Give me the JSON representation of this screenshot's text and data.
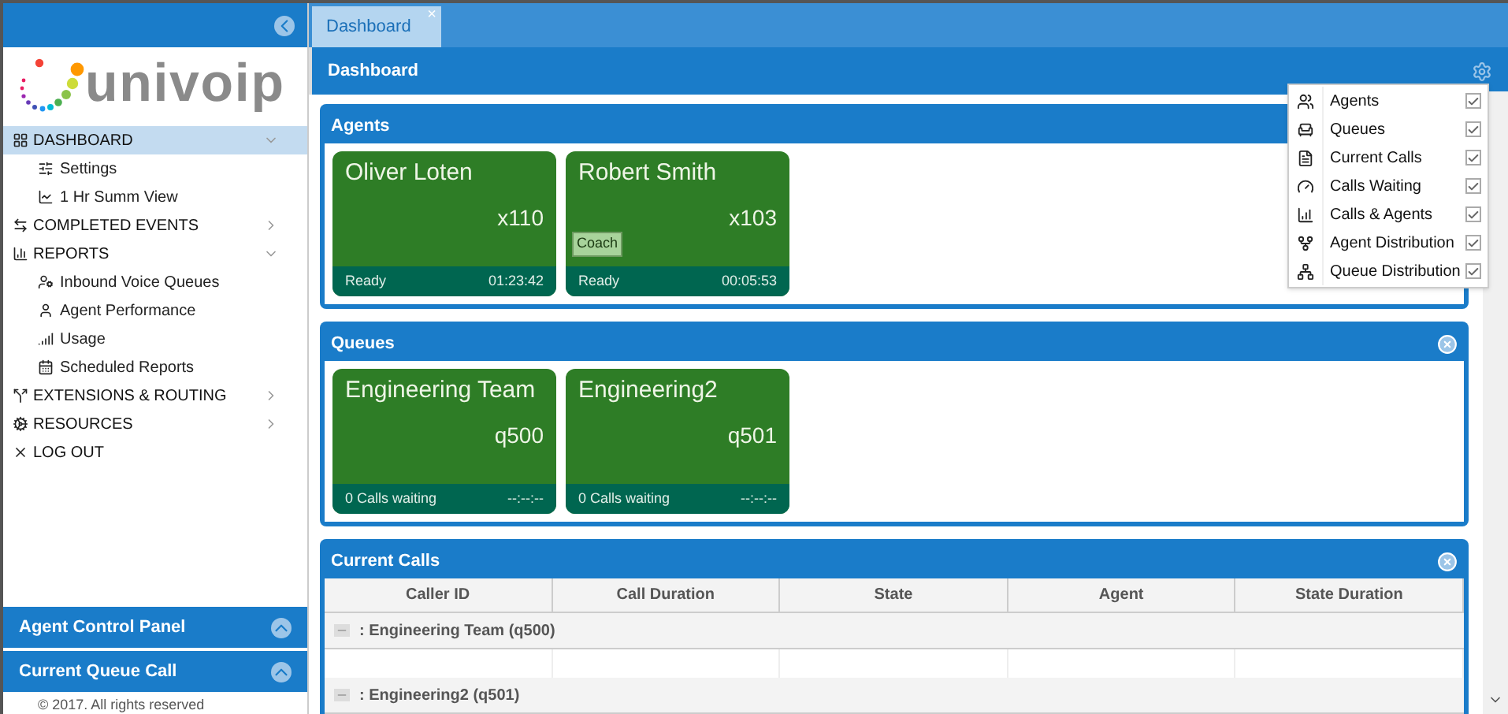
{
  "sidebar": {
    "logo": "univoip",
    "nav": [
      {
        "label": "DASHBOARD",
        "selected": true,
        "expanded": true,
        "children": [
          {
            "label": "Settings"
          },
          {
            "label": "1 Hr Summ View"
          }
        ]
      },
      {
        "label": "COMPLETED EVENTS",
        "selected": false,
        "expanded": false
      },
      {
        "label": "REPORTS",
        "selected": false,
        "expanded": true,
        "children": [
          {
            "label": "Inbound Voice Queues"
          },
          {
            "label": "Agent Performance"
          },
          {
            "label": "Usage"
          },
          {
            "label": "Scheduled Reports"
          }
        ]
      },
      {
        "label": "EXTENSIONS & ROUTING",
        "selected": false,
        "expanded": false
      },
      {
        "label": "RESOURCES",
        "selected": false,
        "expanded": false
      },
      {
        "label": "LOG OUT",
        "selected": false
      }
    ],
    "bottom_panels": [
      {
        "label": "Agent Control Panel"
      },
      {
        "label": "Current Queue Call"
      }
    ],
    "footer": "© 2017. All rights reserved"
  },
  "tabs": [
    {
      "label": "Dashboard",
      "selected": true,
      "close": "×"
    }
  ],
  "page_title": "Dashboard",
  "agents": {
    "title": "Agents",
    "cards": [
      {
        "name": "Oliver Loten",
        "ext": "x110",
        "status": "Ready",
        "time": "01:23:42"
      },
      {
        "name": "Robert Smith",
        "ext": "x103",
        "button": "Coach",
        "status": "Ready",
        "time": "00:05:53"
      }
    ]
  },
  "queues": {
    "title": "Queues",
    "cards": [
      {
        "name": "Engineering Team",
        "ext": "q500",
        "status": "0 Calls waiting",
        "time": "--:--:--"
      },
      {
        "name": "Engineering2",
        "ext": "q501",
        "status": "0 Calls waiting",
        "time": "--:--:--"
      }
    ]
  },
  "current_calls": {
    "title": "Current Calls",
    "columns": [
      "Caller ID",
      "Call Duration",
      "State",
      "Agent",
      "State Duration"
    ],
    "groups": [
      {
        "label": ": Engineering Team (q500)",
        "expanded": true
      },
      {
        "label": ": Engineering2 (q501)",
        "expanded": true
      }
    ]
  },
  "widget_menu": [
    {
      "label": "Agents",
      "checked": true
    },
    {
      "label": "Queues",
      "checked": true
    },
    {
      "label": "Current Calls",
      "checked": true
    },
    {
      "label": "Calls Waiting",
      "checked": true
    },
    {
      "label": "Calls & Agents",
      "checked": true
    },
    {
      "label": "Agent Distribution",
      "checked": true
    },
    {
      "label": "Queue Distribution",
      "checked": true
    }
  ]
}
